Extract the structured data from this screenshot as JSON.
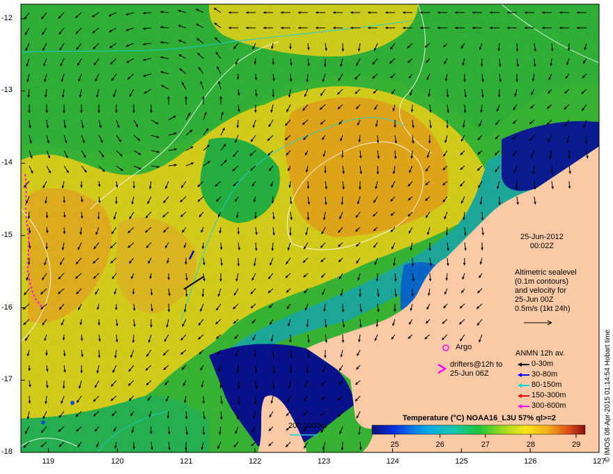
{
  "map": {
    "y_ticks": [
      "-12",
      "-13",
      "-14",
      "-15",
      "-16",
      "-17",
      "-18"
    ],
    "x_ticks": [
      "119",
      "120",
      "121",
      "122",
      "123",
      "124",
      "125",
      "126",
      "127"
    ],
    "lat_range": [
      -18,
      -11.8
    ],
    "lon_range": [
      118.6,
      127
    ]
  },
  "date": {
    "line1": "25-Jun-2012",
    "line2": "00:02Z"
  },
  "altimetry_note": [
    "Altimetric sealevel",
    "(0.1m contours)",
    "and velocity for",
    "25-Jun 00Z",
    "0.5m/s (1kt 24h)"
  ],
  "argo_label": "Argo",
  "drifters_label": [
    "drifters@12h to",
    "25-Jun 06Z"
  ],
  "anmn": {
    "title": "ANMN 12h av.",
    "items": [
      {
        "label": "0-30m",
        "color": "#000000"
      },
      {
        "label": "30-80m",
        "color": "#0000ff"
      },
      {
        "label": "80-150m",
        "color": "#00d8d8"
      },
      {
        "label": "150-300m",
        "color": "#ff0000"
      },
      {
        "label": "300-600m",
        "color": "#ff00ff"
      }
    ]
  },
  "depth_legend": {
    "label": "200  1000m"
  },
  "colorbar": {
    "title": "Temperature (°C) NOAA16_L3U 57% ql>=2",
    "ticks": [
      "25",
      "26",
      "27",
      "28",
      "29"
    ],
    "range": [
      24.5,
      29.2
    ]
  },
  "credit": "© IMOS 08-Apr-2015 01:14:54 Hobart time",
  "colors": {
    "land": "#f9caa5",
    "warm": "#f5b81b",
    "yellow": "#f1e31b",
    "green": "#23c43d",
    "cold": "#0b139e"
  }
}
